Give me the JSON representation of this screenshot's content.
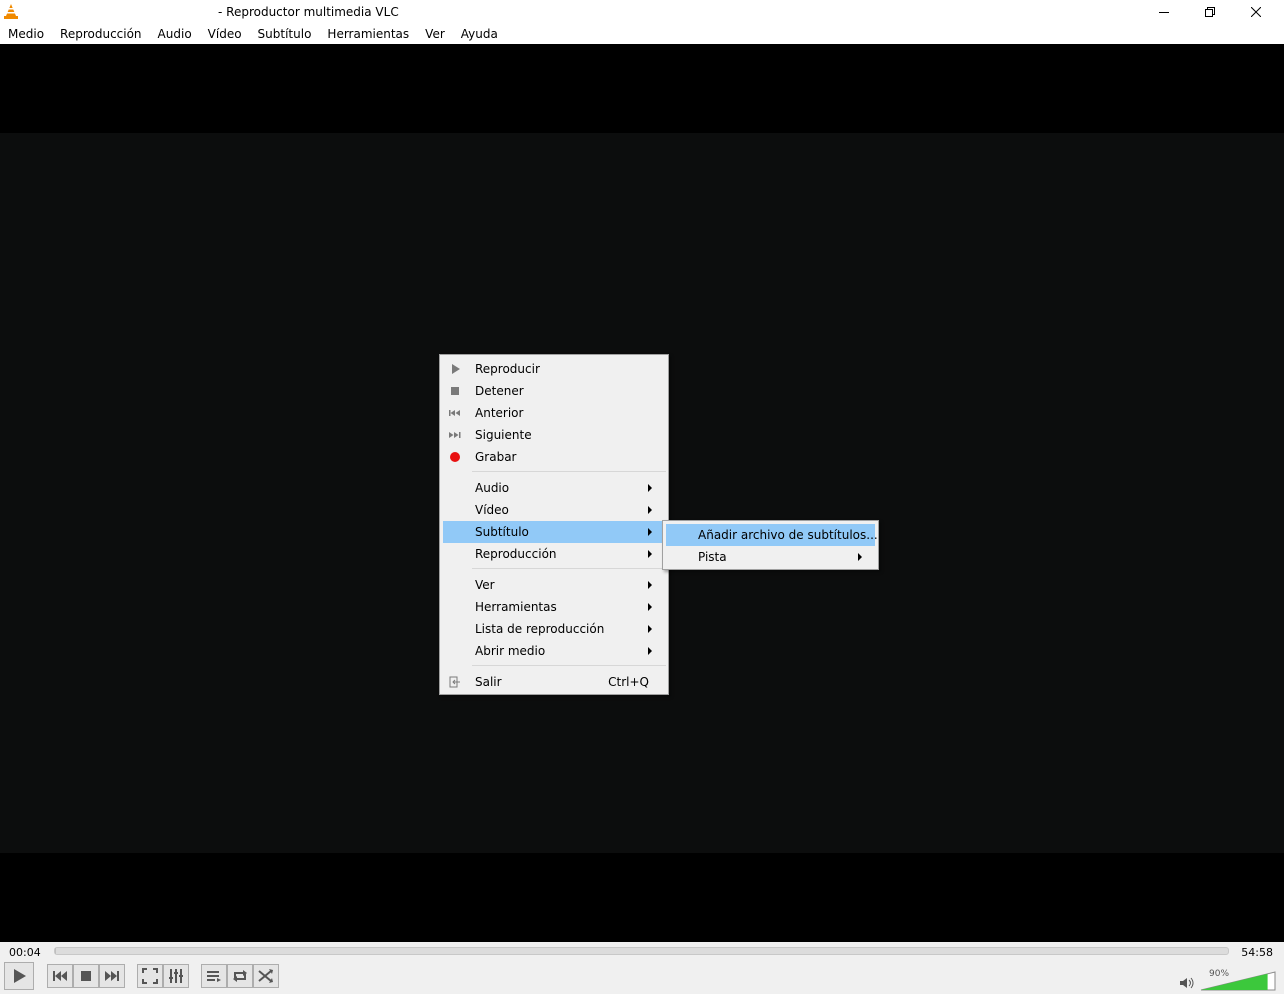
{
  "window": {
    "title": "- Reproductor multimedia VLC",
    "app_icon": "vlc-cone-icon"
  },
  "menubar": {
    "items": [
      "Medio",
      "Reproducción",
      "Audio",
      "Vídeo",
      "Subtítulo",
      "Herramientas",
      "Ver",
      "Ayuda"
    ]
  },
  "context_menu": {
    "items": [
      {
        "label": "Reproducir",
        "icon": "play-icon"
      },
      {
        "label": "Detener",
        "icon": "stop-icon"
      },
      {
        "label": "Anterior",
        "icon": "previous-icon"
      },
      {
        "label": "Siguiente",
        "icon": "next-icon"
      },
      {
        "label": "Grabar",
        "icon": "record-icon"
      },
      {
        "label": "Audio",
        "submenu": true
      },
      {
        "label": "Vídeo",
        "submenu": true
      },
      {
        "label": "Subtítulo",
        "submenu": true,
        "highlighted": true
      },
      {
        "label": "Reproducción",
        "submenu": true
      },
      {
        "label": "Ver",
        "submenu": true
      },
      {
        "label": "Herramientas",
        "submenu": true
      },
      {
        "label": "Lista de reproducción",
        "submenu": true
      },
      {
        "label": "Abrir medio",
        "submenu": true
      },
      {
        "label": "Salir",
        "icon": "exit-icon",
        "shortcut": "Ctrl+Q"
      }
    ]
  },
  "submenu": {
    "items": [
      {
        "label": "Añadir archivo de subtítulos...",
        "highlighted": true
      },
      {
        "label": "Pista",
        "submenu": true
      }
    ]
  },
  "controls": {
    "time_elapsed": "00:04",
    "time_total": "54:58",
    "progress_fraction": 0.0012,
    "volume_label": "90%",
    "volume_fraction": 0.9,
    "volume_color": "#3cc83c"
  },
  "colors": {
    "highlight": "#91c9f7",
    "record_red": "#e81010",
    "vlc_orange": "#f08a00"
  }
}
